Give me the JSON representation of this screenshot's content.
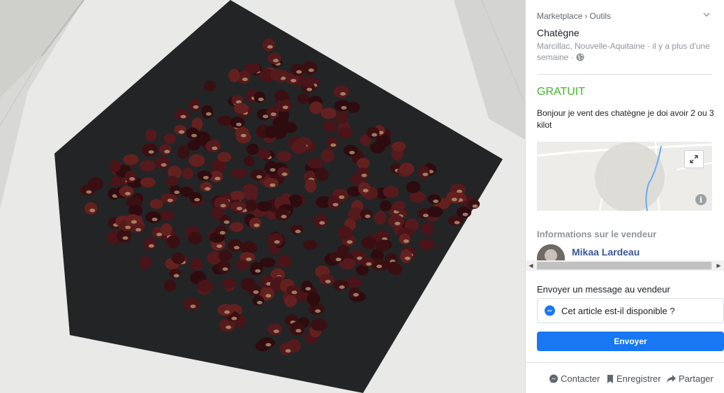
{
  "photo": {
    "icon": "chestnuts-photo"
  },
  "listing": {
    "breadcrumb": {
      "root": "Marketplace",
      "separator": "›",
      "category": "Outils"
    },
    "title": "Chatègne",
    "location": "Marcillac, Nouvelle-Aquitaine · il y a plus d'une semaine ·",
    "price": "GRATUIT",
    "description": "Bonjour je vent des chatègne je doi avoir 2 ou 3 kilot",
    "price_color": "#42b72a"
  },
  "seller": {
    "heading": "Informations sur le vendeur",
    "name": "Mikaa Lardeau",
    "name_color": "#385898"
  },
  "message": {
    "heading": "Envoyer un message au vendeur",
    "input_value": "Cet article est-il disponible ?",
    "send_label": "Envoyer",
    "send_color": "#1877f2"
  },
  "actions": {
    "contact": "Contacter",
    "save": "Enregistrer",
    "share": "Partager"
  }
}
